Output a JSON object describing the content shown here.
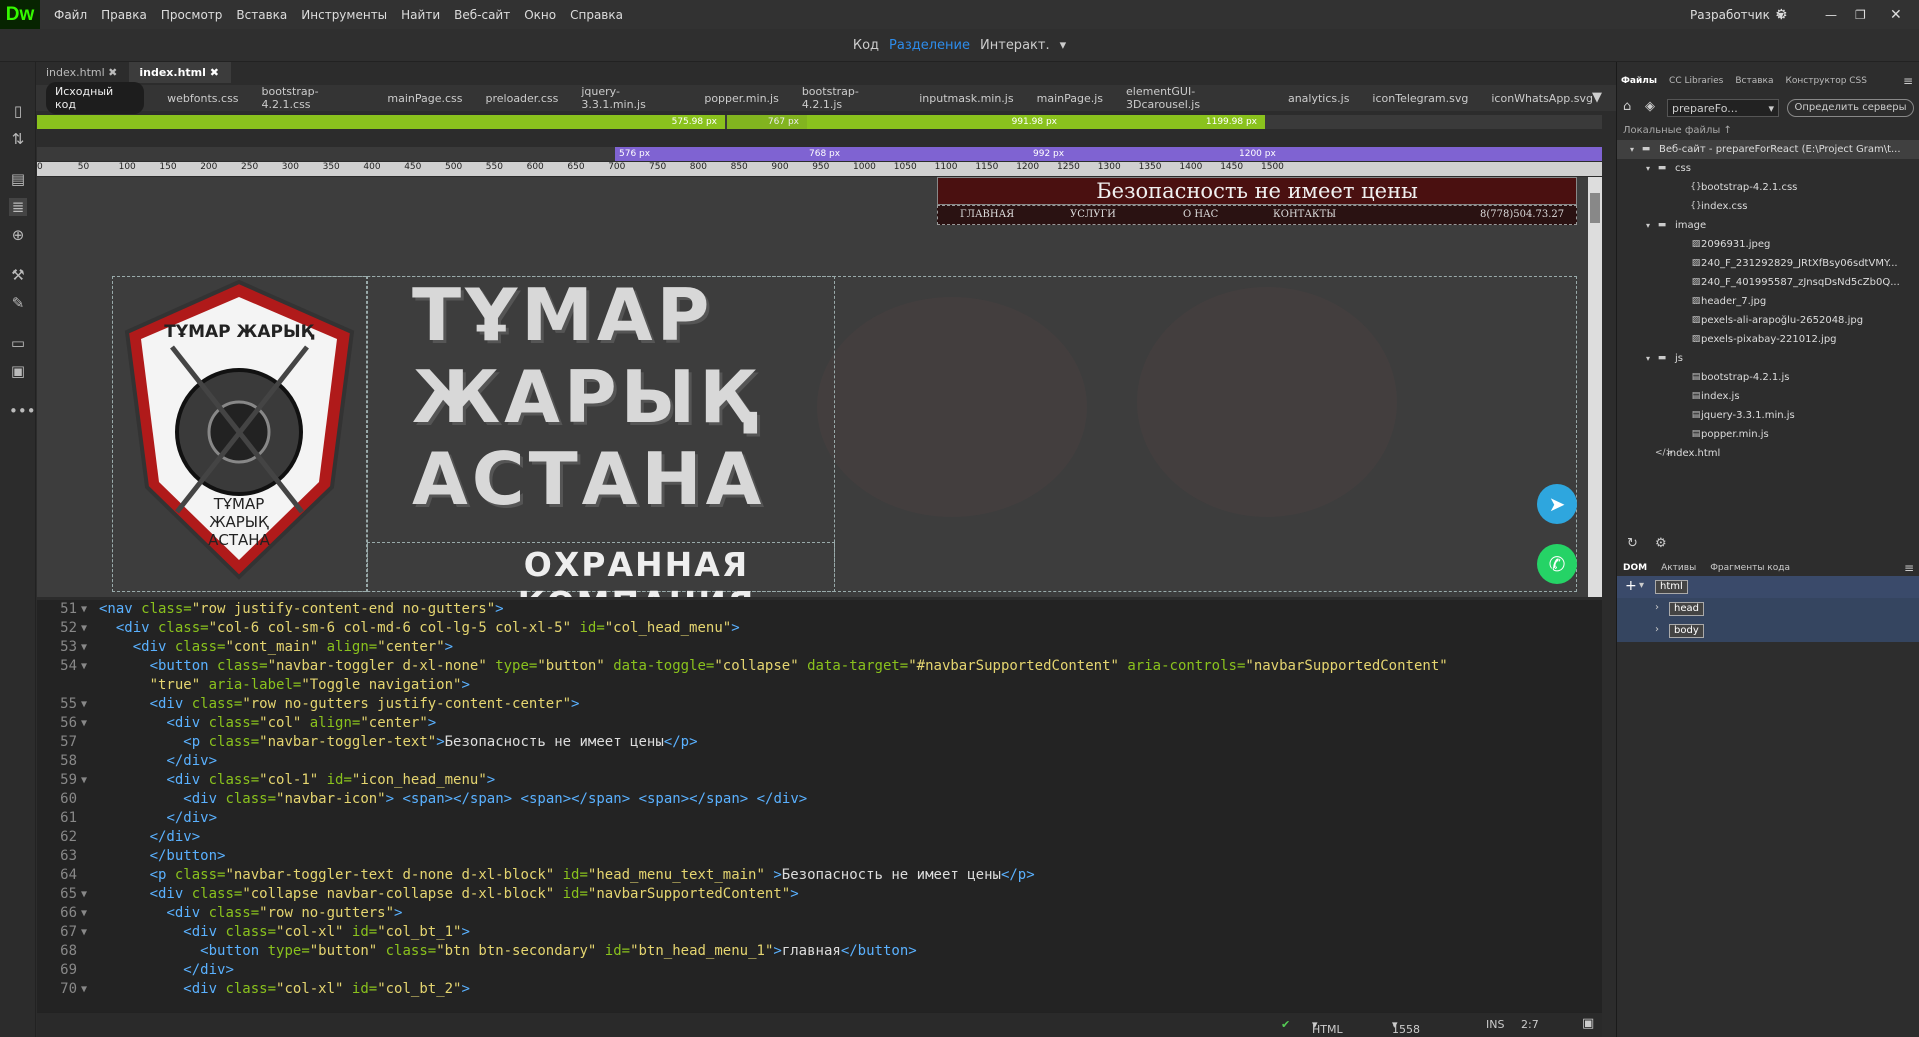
{
  "app": {
    "logo": "Dw",
    "workspace": "Разработчик",
    "colors": {
      "accent": "#35fa00",
      "link": "#2d8ceb"
    }
  },
  "menu": [
    "Файл",
    "Правка",
    "Просмотр",
    "Вставка",
    "Инструменты",
    "Найти",
    "Веб-сайт",
    "Окно",
    "Справка"
  ],
  "view": {
    "code": "Код",
    "split": "Разделение",
    "live": "Интеракт."
  },
  "doc_tabs": [
    "index.html",
    "index.html"
  ],
  "related_files": [
    "Исходный код",
    "webfonts.css",
    "bootstrap-4.2.1.css",
    "mainPage.css",
    "preloader.css",
    "jquery-3.3.1.min.js",
    "popper.min.js",
    "bootstrap-4.2.1.js",
    "inputmask.min.js",
    "mainPage.js",
    "elementGUI-3Dcarousel.js",
    "analytics.js",
    "iconTelegram.svg",
    "iconWhatsApp.svg"
  ],
  "mq_green": [
    "575.98 px",
    "767 px",
    "991.98 px",
    "1199.98 px"
  ],
  "mq_purple": [
    "576 px",
    "768 px",
    "992 px",
    "1200 px"
  ],
  "ruler": [
    "0",
    "50",
    "100",
    "150",
    "200",
    "250",
    "300",
    "350",
    "400",
    "450",
    "500",
    "550",
    "600",
    "650",
    "700",
    "750",
    "800",
    "850",
    "900",
    "950",
    "1000",
    "1050",
    "1100",
    "1150",
    "1200",
    "1250",
    "1300",
    "1350",
    "1400",
    "1450",
    "1500"
  ],
  "page": {
    "headline": "Безопасность не имеет цены",
    "nav": [
      "ГЛАВНАЯ",
      "УСЛУГИ",
      "О НАС",
      "КОНТАКТЫ"
    ],
    "phone": "8(778)504.73.27",
    "shield_title": "ТҰМАР ЖАРЫҚ",
    "shield_bottom": [
      "ТҰМАР",
      "ЖАРЫҚ",
      "АСТАНА"
    ],
    "title_lines": [
      "ТҰМАР",
      "ЖАРЫҚ",
      "АСТАНА"
    ],
    "subtitle": "ОХРАННАЯ КОМПАНИЯ"
  },
  "code_lines": [
    {
      "n": "51",
      "f": "▼",
      "c": "<nav class=\"row justify-content-end no-gutters\">"
    },
    {
      "n": "52",
      "f": "▼",
      "c": "  <div class=\"col-6 col-sm-6 col-md-6 col-lg-5 col-xl-5\" id=\"col_head_menu\">"
    },
    {
      "n": "53",
      "f": "▼",
      "c": "    <div class=\"cont_main\" align=\"center\">"
    },
    {
      "n": "54",
      "f": "▼",
      "c": "      <button class=\"navbar-toggler d-xl-none\" type=\"button\" data-toggle=\"collapse\" data-target=\"#navbarSupportedContent\" aria-controls=\"navbarSupportedContent\""
    },
    {
      "n": "",
      "f": "",
      "c": "      aria-expanded=\"true\" aria-label=\"Toggle navigation\">"
    },
    {
      "n": "55",
      "f": "▼",
      "c": "      <div class=\"row no-gutters justify-content-center\">"
    },
    {
      "n": "56",
      "f": "▼",
      "c": "        <div class=\"col\" align=\"center\">"
    },
    {
      "n": "57",
      "f": "",
      "c": "          <p class=\"navbar-toggler-text\">Безопасность не имеет цены</p>"
    },
    {
      "n": "58",
      "f": "",
      "c": "        </div>"
    },
    {
      "n": "59",
      "f": "▼",
      "c": "        <div class=\"col-1\" id=\"icon_head_menu\">"
    },
    {
      "n": "60",
      "f": "",
      "c": "          <div class=\"navbar-icon\"> <span></span> <span></span> <span></span> </div>"
    },
    {
      "n": "61",
      "f": "",
      "c": "        </div>"
    },
    {
      "n": "62",
      "f": "",
      "c": "      </div>"
    },
    {
      "n": "63",
      "f": "",
      "c": "      </button>"
    },
    {
      "n": "64",
      "f": "",
      "c": "      <p class=\"navbar-toggler-text d-none d-xl-block\" id=\"head_menu_text_main\" >Безопасность не имеет цены</p>"
    },
    {
      "n": "65",
      "f": "▼",
      "c": "      <div class=\"collapse navbar-collapse d-xl-block\" id=\"navbarSupportedContent\">"
    },
    {
      "n": "66",
      "f": "▼",
      "c": "        <div class=\"row no-gutters\">"
    },
    {
      "n": "67",
      "f": "▼",
      "c": "          <div class=\"col-xl\" id=\"col_bt_1\">"
    },
    {
      "n": "68",
      "f": "",
      "c": "            <button type=\"button\" class=\"btn btn-secondary\" id=\"btn_head_menu_1\">главная</button>"
    },
    {
      "n": "69",
      "f": "",
      "c": "          </div>"
    },
    {
      "n": "70",
      "f": "▼",
      "c": "          <div class=\"col-xl\" id=\"col_bt_2\">"
    }
  ],
  "status": {
    "lang": "HTML",
    "size": "1558 x 419",
    "mode": "INS",
    "pos": "2:7"
  },
  "right_panel": {
    "tabs": [
      "Файлы",
      "CC Libraries",
      "Вставка",
      "Конструктор CSS"
    ],
    "site_select": "prepareFo...",
    "define_servers": "Определить серверы",
    "local_files": "Локальные файлы",
    "files": [
      {
        "name": "Веб-сайт - prepareForReact (E:\\Project Gram\\t...",
        "icon": "folder",
        "level": 0
      },
      {
        "name": "css",
        "icon": "folder",
        "level": 1
      },
      {
        "name": "bootstrap-4.2.1.css",
        "icon": "css",
        "level": 2
      },
      {
        "name": "index.css",
        "icon": "css",
        "level": 2
      },
      {
        "name": "image",
        "icon": "folder",
        "level": 1
      },
      {
        "name": "2096931.jpeg",
        "icon": "img",
        "level": 2
      },
      {
        "name": "240_F_231292829_JRtXfBsy06sdtVMY...",
        "icon": "img",
        "level": 2
      },
      {
        "name": "240_F_401995587_zJnsqDsNd5cZb0Q...",
        "icon": "img",
        "level": 2
      },
      {
        "name": "header_7.jpg",
        "icon": "img",
        "level": 2
      },
      {
        "name": "pexels-ali-arapoğlu-2652048.jpg",
        "icon": "img",
        "level": 2
      },
      {
        "name": "pexels-pixabay-221012.jpg",
        "icon": "img",
        "level": 2
      },
      {
        "name": "js",
        "icon": "folder",
        "level": 1
      },
      {
        "name": "bootstrap-4.2.1.js",
        "icon": "js",
        "level": 2
      },
      {
        "name": "index.js",
        "icon": "js",
        "level": 2
      },
      {
        "name": "jquery-3.3.1.min.js",
        "icon": "js",
        "level": 2
      },
      {
        "name": "popper.min.js",
        "icon": "js",
        "level": 2
      },
      {
        "name": "index.html",
        "icon": "html",
        "level": 1
      }
    ],
    "dom_tabs": [
      "DOM",
      "Активы",
      "Фрагменты кода"
    ],
    "dom_tags": [
      "html",
      "head",
      "body"
    ]
  }
}
